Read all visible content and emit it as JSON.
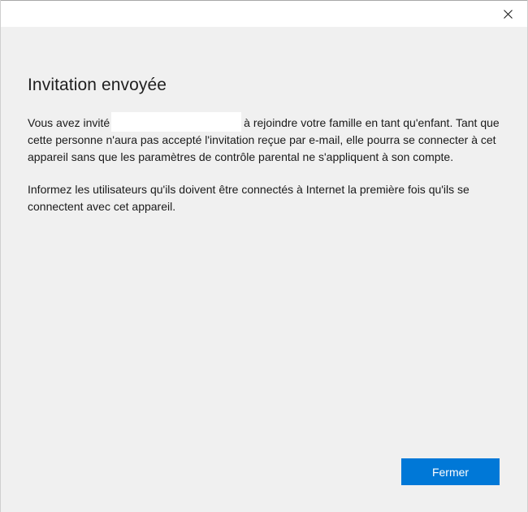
{
  "dialog": {
    "title": "Invitation envoyée",
    "message1_prefix": "Vous avez invité",
    "message1_suffix": "à rejoindre votre famille en tant qu'enfant. Tant que cette personne n'aura pas accepté l'invitation reçue par e-mail, elle pourra se connecter à cet appareil sans que les paramètres de contrôle parental ne s'appliquent à son compte.",
    "message2": "Informez les utilisateurs qu'ils doivent être connectés à Internet la première fois qu'ils se connectent avec cet appareil.",
    "close_button_label": "Fermer",
    "titlebar_close_icon": "close-icon",
    "accent_color": "#0078d7",
    "background_color": "#f0f0f0"
  }
}
